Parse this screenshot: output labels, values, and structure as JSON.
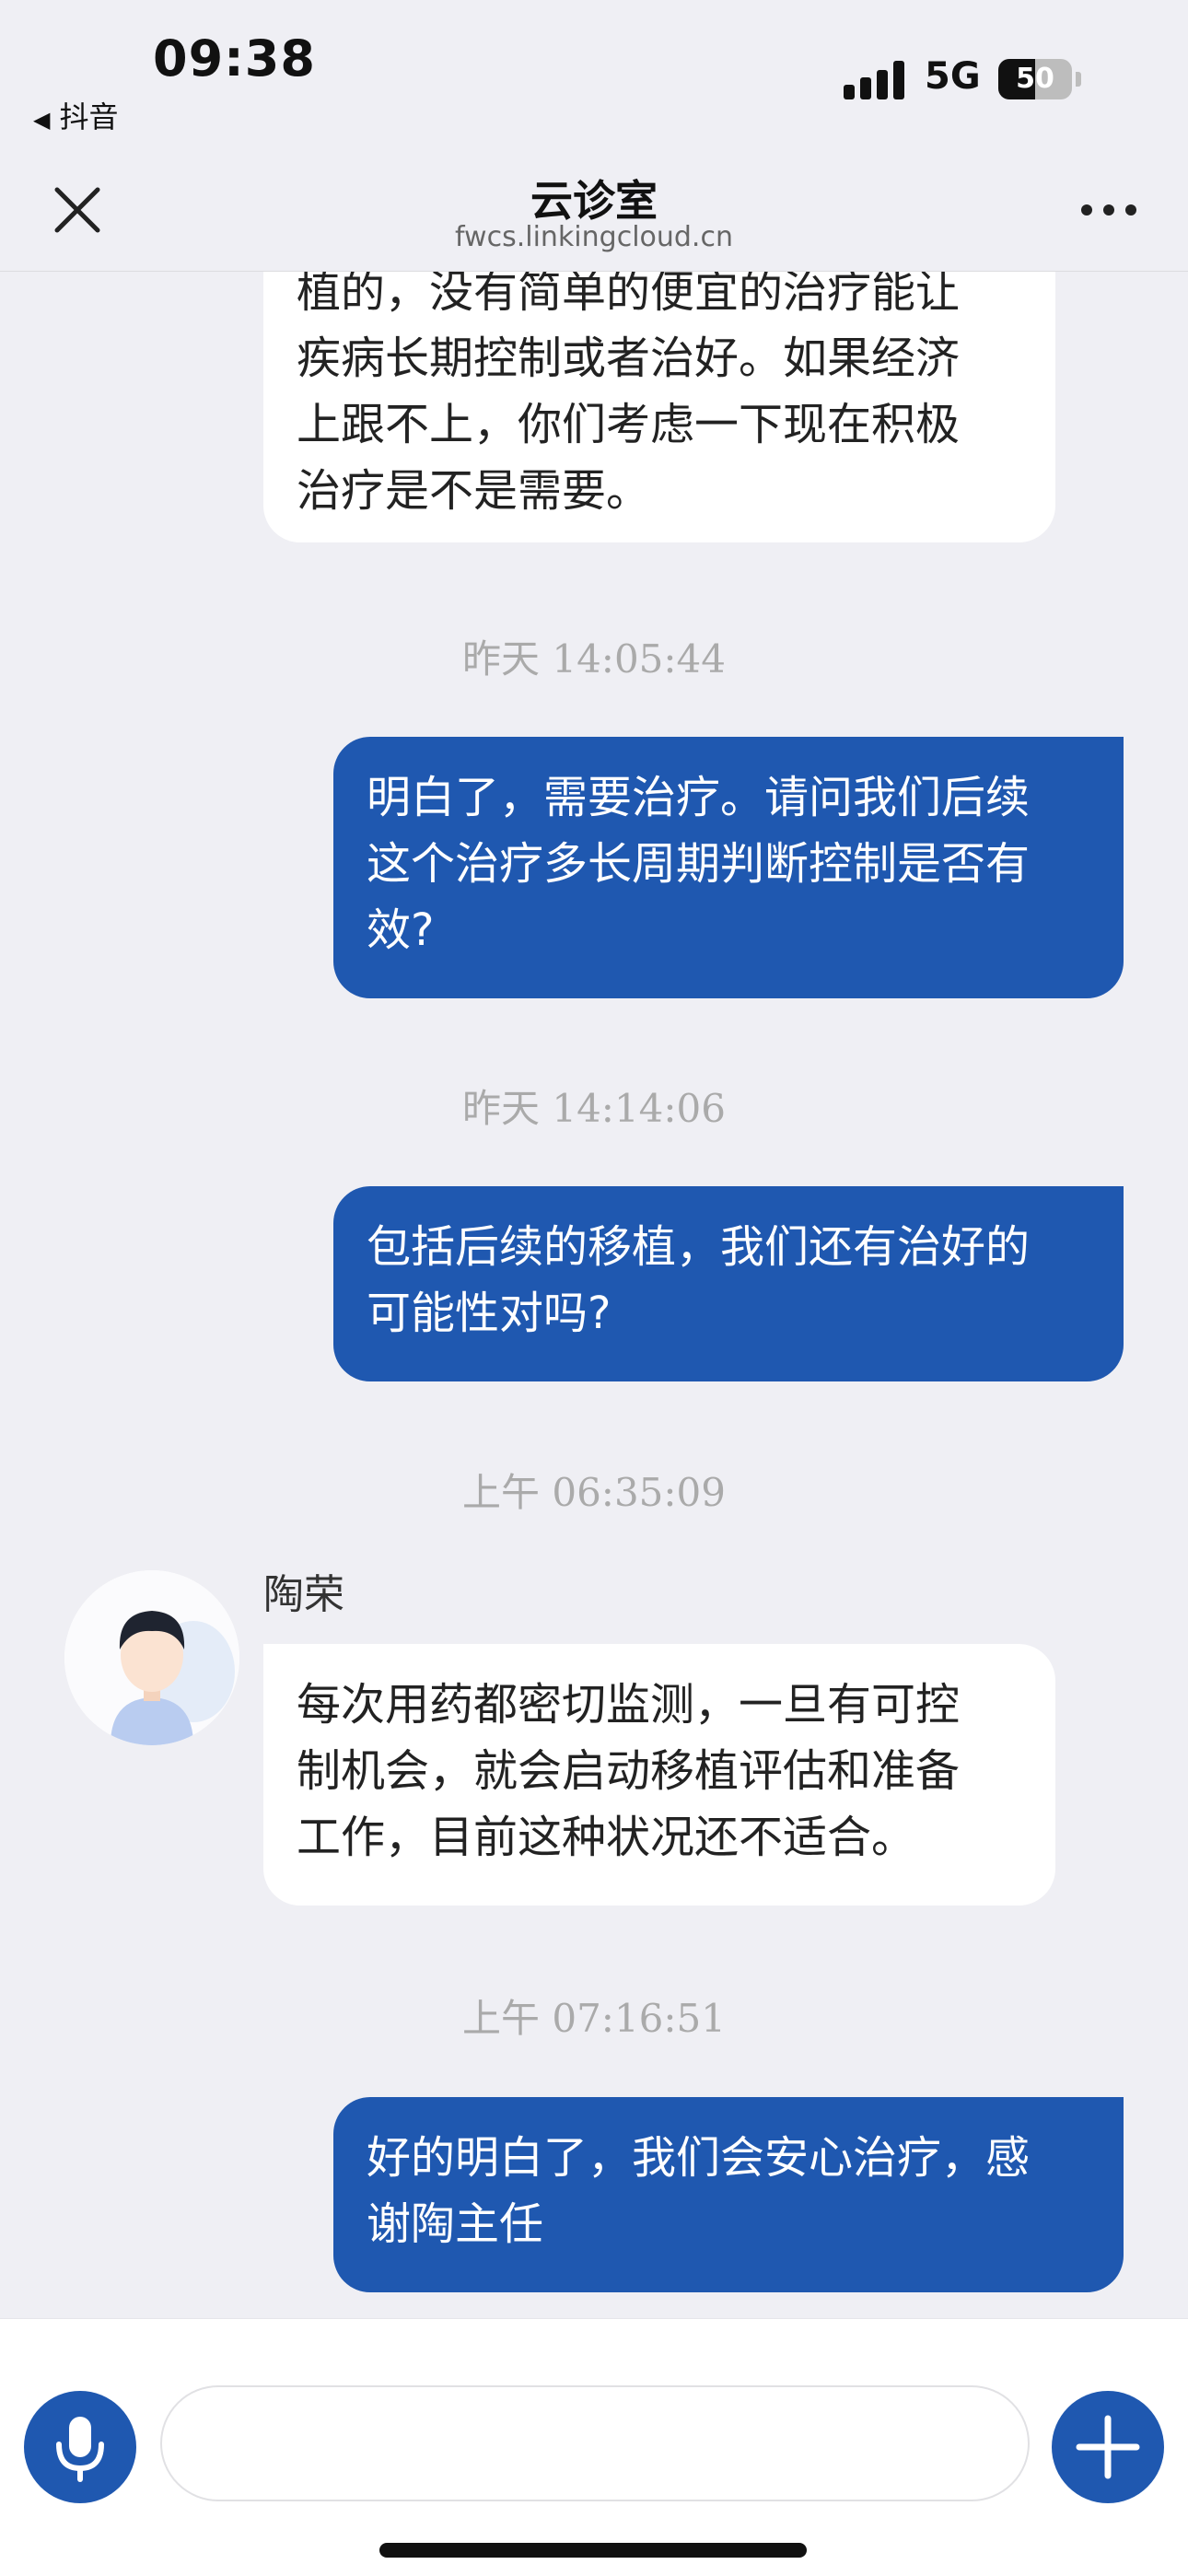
{
  "status_bar": {
    "time": "09:38",
    "back_app_label": "抖音",
    "network": "5G",
    "battery_percent": 50,
    "battery_text": "50",
    "icons": [
      "signal-icon",
      "battery-icon",
      "back-arrow-icon"
    ]
  },
  "header": {
    "title": "云诊室",
    "url": "fwcs.linkingcloud.cn",
    "icons": [
      "close-icon",
      "more-icon"
    ]
  },
  "conversation": {
    "messages": [
      {
        "direction": "incoming",
        "lines": [
          "植的，没有简单的便宜的治疗能让",
          "疾病长期控制或者治好。如果经济",
          "上跟不上，你们考虑一下现在积极",
          "治疗是不是需要。"
        ]
      },
      {
        "type": "timestamp",
        "text": "昨天 14:05:44"
      },
      {
        "direction": "outgoing",
        "lines": [
          "明白了，需要治疗。请问我们后续",
          "这个治疗多长周期判断控制是否有",
          "效?"
        ]
      },
      {
        "type": "timestamp",
        "text": "昨天 14:14:06"
      },
      {
        "direction": "outgoing",
        "lines": [
          "包括后续的移植，我们还有治好的",
          "可能性对吗?"
        ]
      },
      {
        "type": "timestamp",
        "text": "上午 06:35:09"
      },
      {
        "direction": "incoming",
        "sender": "陶荣",
        "lines": [
          "每次用药都密切监测，一旦有可控",
          "制机会，就会启动移植评估和准备",
          "工作，目前这种状况还不适合。"
        ]
      },
      {
        "type": "timestamp",
        "text": "上午 07:16:51"
      },
      {
        "direction": "outgoing",
        "lines": [
          "好的明白了，我们会安心治疗，感",
          "谢陶主任"
        ]
      }
    ]
  },
  "input_bar": {
    "placeholder": "",
    "value": "",
    "icons": [
      "microphone-icon",
      "plus-icon"
    ]
  },
  "colors": {
    "background": "#efeff4",
    "outgoing_bubble": "#1f58b0",
    "incoming_bubble": "#ffffff",
    "timestamp_text": "#aaaaaa",
    "accent": "#1f58b0"
  }
}
